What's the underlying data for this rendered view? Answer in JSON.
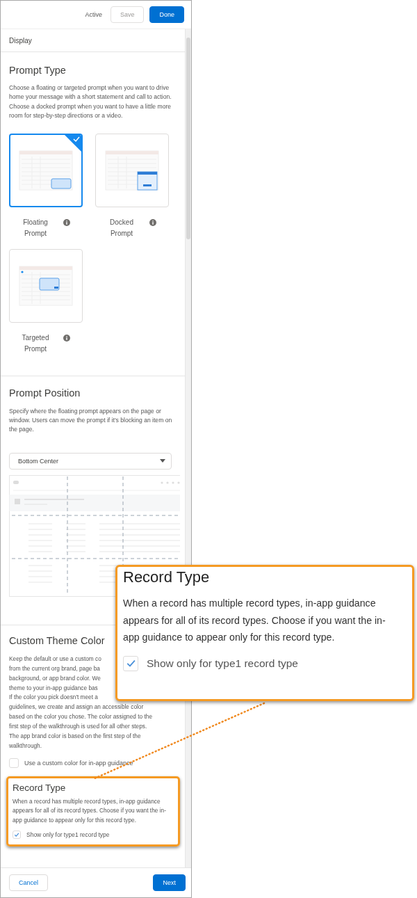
{
  "header": {
    "status": "Active",
    "buttons": [
      {
        "label": "Save",
        "kind": "neutral",
        "disabled": true
      },
      {
        "label": "Done",
        "kind": "brand",
        "disabled": false
      }
    ]
  },
  "section_header": "Display",
  "prompt_type": {
    "title": "Prompt Type",
    "description": "Choose a floating or targeted prompt when you want to drive home your message with a short statement and call to action. Choose a docked prompt when you want to have a little more room for step-by-step directions or a video.",
    "options": [
      {
        "label": "Floating Prompt",
        "kind": "floating",
        "selected": true
      },
      {
        "label": "Docked Prompt",
        "kind": "docked",
        "selected": false
      },
      {
        "label": "Targeted Prompt",
        "kind": "targeted",
        "selected": false
      }
    ]
  },
  "prompt_position": {
    "title": "Prompt Position",
    "description": "Specify where the floating prompt appears on the page or window. Users can move the prompt if it's blocking an item on the page.",
    "select": {
      "value": "Bottom Center"
    }
  },
  "custom_theme": {
    "title": "Custom Theme Color",
    "description_lines": [
      "Keep the default or use a custom co",
      "from the current org brand, page ba",
      "background, or app brand color. We",
      "theme to your in-app guidance bas",
      "If the color you pick doesn't meet a",
      "guidelines, we create and assign an accessible color",
      "based on the color you chose. The color assigned to the",
      "first step of the walkthrough is used for all other steps.",
      "The app brand color is based on the first step of the",
      "walkthrough."
    ],
    "checkbox": {
      "label": "Use a custom color for in-app guidance",
      "checked": false
    }
  },
  "record_type": {
    "title": "Record Type",
    "description": "When a record has multiple record types, in-app guidance appears for all of its record types. Choose if you want the in-app guidance to appear only for this record type.",
    "checkbox": {
      "label": "Show only for type1 record type",
      "checked": true
    }
  },
  "footer": {
    "buttons": [
      {
        "label": "Cancel",
        "kind": "neutral",
        "disabled": false
      },
      {
        "label": "Next",
        "kind": "brand",
        "disabled": false
      }
    ]
  },
  "callout": {
    "title": "Record Type",
    "description": "When a record has multiple record types, in-app guidance appears for all of its record types. Choose if you want the in-app guidance to appear only for this record type.",
    "checkbox": {
      "label": "Show only for type1 record type",
      "checked": true
    }
  }
}
